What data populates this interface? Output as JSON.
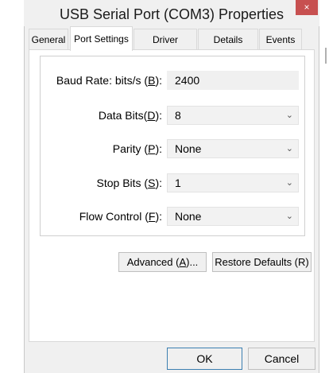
{
  "window": {
    "title": "USB Serial Port (COM3) Properties",
    "close_glyph": "×"
  },
  "tabs": [
    {
      "label": "General",
      "active": false
    },
    {
      "label": "Port Settings",
      "active": true
    },
    {
      "label": "Driver",
      "active": false
    },
    {
      "label": "Details",
      "active": false
    },
    {
      "label": "Events",
      "active": false
    }
  ],
  "settings": {
    "baud": {
      "label_pre": "Baud Rate: bits/s (",
      "key": "B",
      "label_post": "):",
      "value": "2400"
    },
    "data_bits": {
      "label_pre": "Data Bits(",
      "key": "D",
      "label_post": "):",
      "value": "8"
    },
    "parity": {
      "label_pre": "Parity (",
      "key": "P",
      "label_post": "):",
      "value": "None"
    },
    "stop_bits": {
      "label_pre": "Stop Bits (",
      "key": "S",
      "label_post": "):",
      "value": "1"
    },
    "flow_control": {
      "label_pre": "Flow Control (",
      "key": "F",
      "label_post": "):",
      "value": "None"
    }
  },
  "buttons": {
    "advanced": {
      "pre": "Advanced (",
      "key": "A",
      "post": ")..."
    },
    "restore": "Restore Defaults (R)",
    "ok": "OK",
    "cancel": "Cancel"
  },
  "chevron_glyph": "⌄"
}
